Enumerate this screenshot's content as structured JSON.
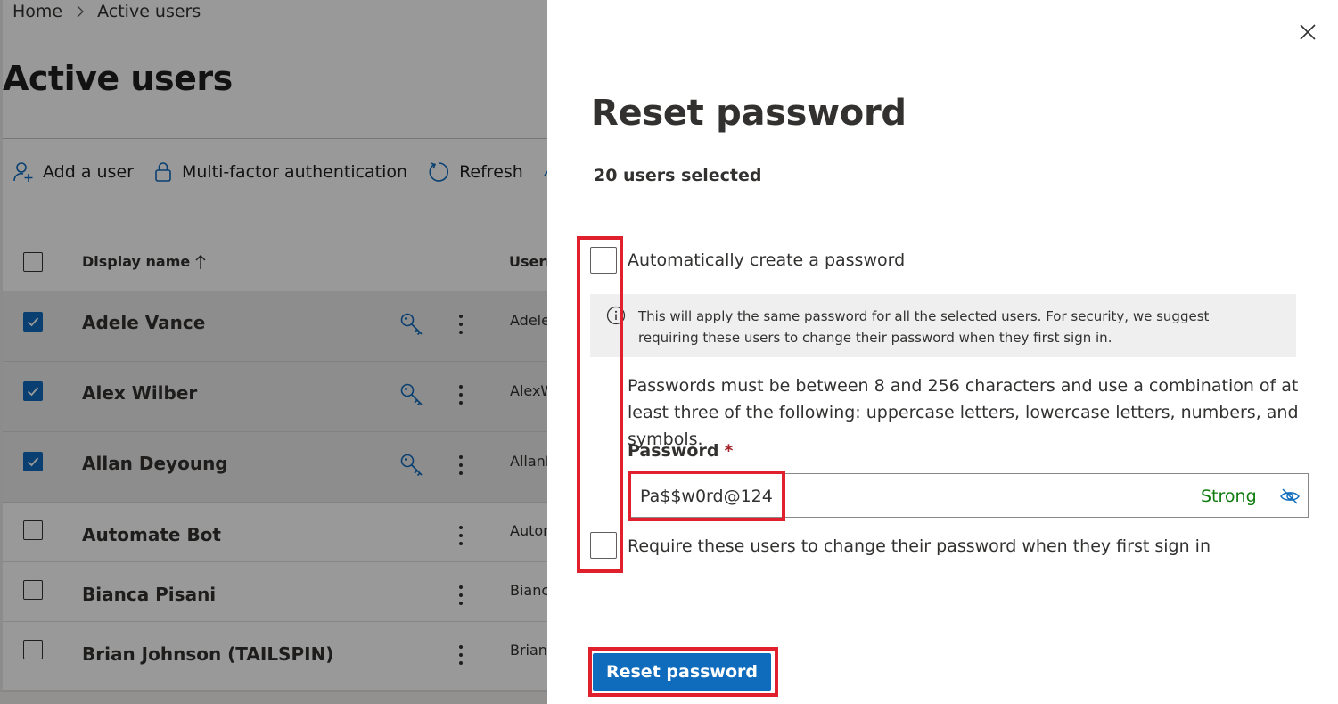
{
  "background": {
    "breadcrumb": {
      "home": "Home",
      "current": "Active users"
    },
    "page_title": "Active users",
    "toolbar": {
      "add_user": "Add a user",
      "mfa": "Multi-factor authentication",
      "refresh": "Refresh"
    },
    "table": {
      "columns": {
        "display_name": "Display name",
        "username": "Usern"
      },
      "rows": [
        {
          "name": "Adele Vance",
          "upn": "Adele",
          "selected": true
        },
        {
          "name": "Alex Wilber",
          "upn": "AlexW",
          "selected": true
        },
        {
          "name": "Allan Deyoung",
          "upn": "AllanI",
          "selected": true
        },
        {
          "name": "Automate Bot",
          "upn": "Autor",
          "selected": false
        },
        {
          "name": "Bianca Pisani",
          "upn": "Bianc",
          "selected": false
        },
        {
          "name": "Brian Johnson (TAILSPIN)",
          "upn": "Brian.",
          "selected": false
        }
      ]
    }
  },
  "panel": {
    "title": "Reset password",
    "selected_count": "20 users selected",
    "auto_create_label": "Automatically create a password",
    "auto_create_checked": false,
    "info_text": "This will apply the same password for all the selected users. For security, we suggest requiring these users to change their password when they first sign in.",
    "rules_text": "Passwords must be between 8 and 256 characters and use a combination of at least three of the following: uppercase letters, lowercase letters, numbers, and symbols.",
    "password_label": "Password",
    "required_mark": "*",
    "password_value": "Pa$$w0rd@124",
    "strength": "Strong",
    "require_change_label": "Require these users to change their password when they first sign in",
    "require_change_checked": false,
    "submit_label": "Reset password"
  },
  "colors": {
    "accent": "#0f6cbd",
    "highlight": "#e0202c",
    "strong": "#107c10",
    "required": "#a4262c"
  }
}
